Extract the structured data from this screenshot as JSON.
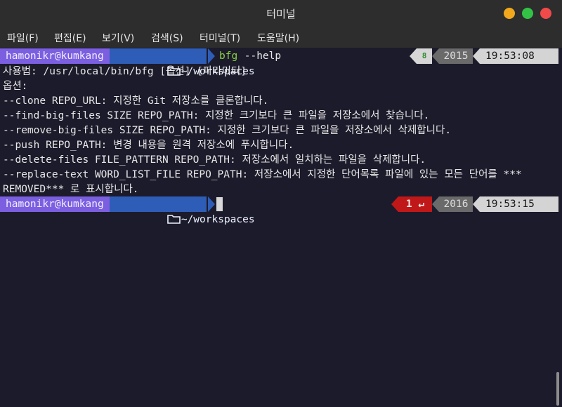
{
  "window": {
    "title": "터미널",
    "colors": {
      "close": "#f04a4a",
      "minimize": "#f2a81c",
      "maximize": "#33c246"
    }
  },
  "menu": [
    "파일(F)",
    "편집(E)",
    "보기(V)",
    "검색(S)",
    "터미널(T)",
    "도움말(H)"
  ],
  "prompts": [
    {
      "user": "hamonikr@kumkang",
      "path": "~/workspaces",
      "command": "bfg",
      "args": " --help",
      "status": "8",
      "history": "2015",
      "time": "19:53:08"
    },
    {
      "user": "hamonikr@kumkang",
      "path": "~/workspaces",
      "status": "1 ↵",
      "history": "2016",
      "time": "19:53:15"
    }
  ],
  "output": [
    "사용법: /usr/local/bin/bfg [옵션] [파라미터]",
    "옵션:",
    "--clone REPO_URL: 지정한 Git 저장소를 클론합니다.",
    "--find-big-files SIZE REPO_PATH: 지정한 크기보다 큰 파일을 저장소에서 찾습니다.",
    "--remove-big-files SIZE REPO_PATH: 지정한 크기보다 큰 파일을 저장소에서 삭제합니다.",
    "--push REPO_PATH: 변경 내용을 원격 저장소에 푸시합니다.",
    "--delete-files FILE_PATTERN REPO_PATH: 저장소에서 일치하는 파일을 삭제합니다.",
    "--replace-text WORD_LIST_FILE REPO_PATH: 저장소에서 지정한 단어목록 파일에 있는 모든 단어를 ***",
    "REMOVED*** 로 표시합니다."
  ]
}
